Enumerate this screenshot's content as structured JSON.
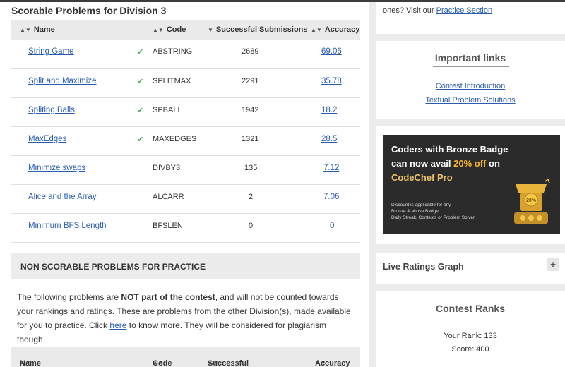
{
  "main": {
    "title": "Scorable Problems for Division 3",
    "headers": {
      "name": "Name",
      "code": "Code",
      "submissions": "Successful Submissions",
      "accuracy": "Accuracy"
    },
    "problems": [
      {
        "name": "String Game",
        "solved": true,
        "code": "ABSTRING",
        "submissions": "2689",
        "accuracy": "69.06"
      },
      {
        "name": "Split and Maximize",
        "solved": true,
        "code": "SPLITMAX",
        "submissions": "2291",
        "accuracy": "35.78"
      },
      {
        "name": "Spliting Balls",
        "solved": true,
        "code": "SPBALL",
        "submissions": "1942",
        "accuracy": "18.2"
      },
      {
        "name": "MaxEdges",
        "solved": true,
        "code": "MAXEDGES",
        "submissions": "1321",
        "accuracy": "28.5"
      },
      {
        "name": "Minimize swaps",
        "solved": false,
        "code": "DIVBY3",
        "submissions": "135",
        "accuracy": "7.12"
      },
      {
        "name": "Alice and the Array",
        "solved": false,
        "code": "ALCARR",
        "submissions": "2",
        "accuracy": "7.06"
      },
      {
        "name": "Minimum BFS Length",
        "solved": false,
        "code": "BFSLEN",
        "submissions": "0",
        "accuracy": "0"
      }
    ],
    "nonscorable_title": "NON SCORABLE PROBLEMS FOR PRACTICE",
    "para": {
      "p1": "The following problems are ",
      "bold": "NOT part of the contest",
      "p2": ", and will not be counted towards your rankings and ratings. These are problems from the other Division(s), made available for you to practice. Click ",
      "link": "here",
      "p3": " to know more. They will be considered for plagiarism though."
    },
    "headers2": {
      "name": "Name",
      "code": "Code",
      "submissions": "Successful Submissions",
      "accuracy": "Accuracy"
    }
  },
  "sidebar": {
    "practice_text": "ones? Visit our ",
    "practice_link": "Practice Section",
    "important_links_title": "Important links",
    "links": [
      "Contest Introduction",
      "Textual Problem Solutions"
    ],
    "promo": {
      "line1": "Coders with Bronze Badge",
      "line2a": "can now avail ",
      "line2b": "20% off",
      "line2c": " on",
      "brand": "CodeChef Pro",
      "small1": "Discount is applicable for any",
      "small2": "Bronze & above Badge",
      "small3": "Daily Streak, Contests or Problem Solver",
      "badge": "20%"
    },
    "live_ratings": "Live Ratings Graph",
    "plus": "+",
    "contest_ranks_title": "Contest Ranks",
    "your_rank": "Your Rank: 133",
    "score": "Score: 400"
  },
  "icons": {
    "sort": "sort-icon",
    "check": "check-icon",
    "plus": "plus-icon"
  },
  "colors": {
    "link": "#2a5db0",
    "check": "#4caf50",
    "promo_highlight": "#f5b52a"
  }
}
